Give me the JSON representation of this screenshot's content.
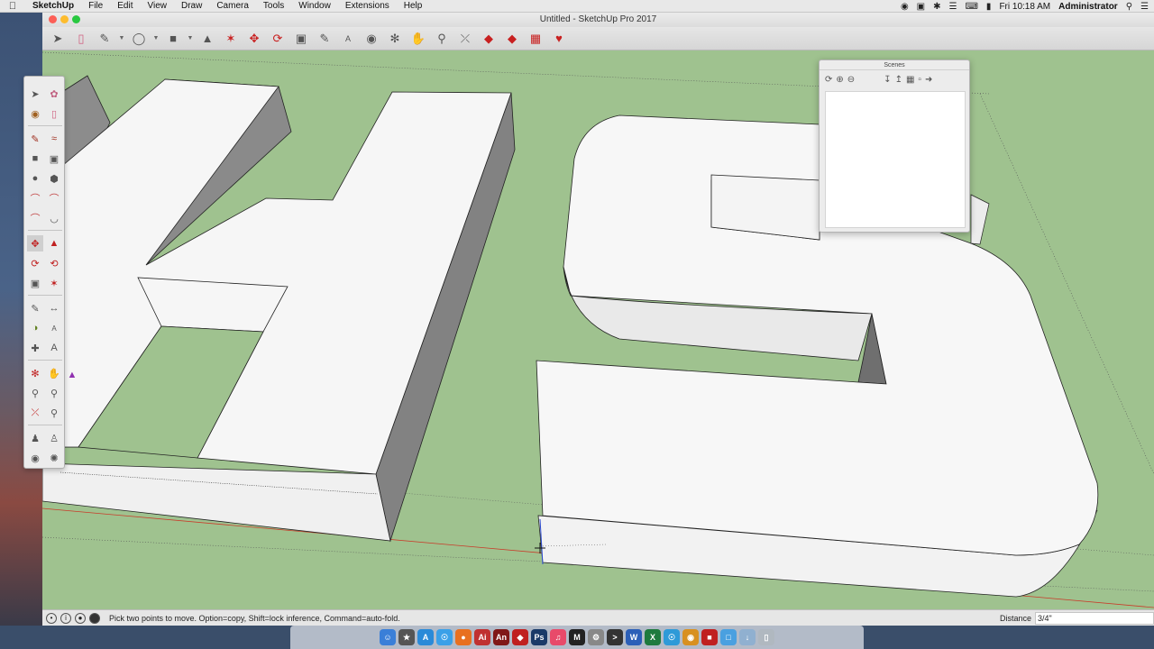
{
  "menubar": {
    "apple": "",
    "app_name": "SketchUp",
    "items": [
      "File",
      "Edit",
      "View",
      "Draw",
      "Camera",
      "Tools",
      "Window",
      "Extensions",
      "Help"
    ],
    "clock": "Fri 10:18 AM",
    "user": "Administrator"
  },
  "window": {
    "title": "Untitled - SketchUp Pro 2017"
  },
  "scenes_panel": {
    "title": "Scenes"
  },
  "statusbar": {
    "hint": "Pick two points to move.  Option=copy, Shift=lock inference, Command=auto-fold.",
    "distance_label": "Distance",
    "distance_value": "3/4\""
  },
  "colors": {
    "viewport_ground": "#9fc28f",
    "axis_red": "#c83c2a",
    "axis_blue": "#2a4ad0"
  }
}
